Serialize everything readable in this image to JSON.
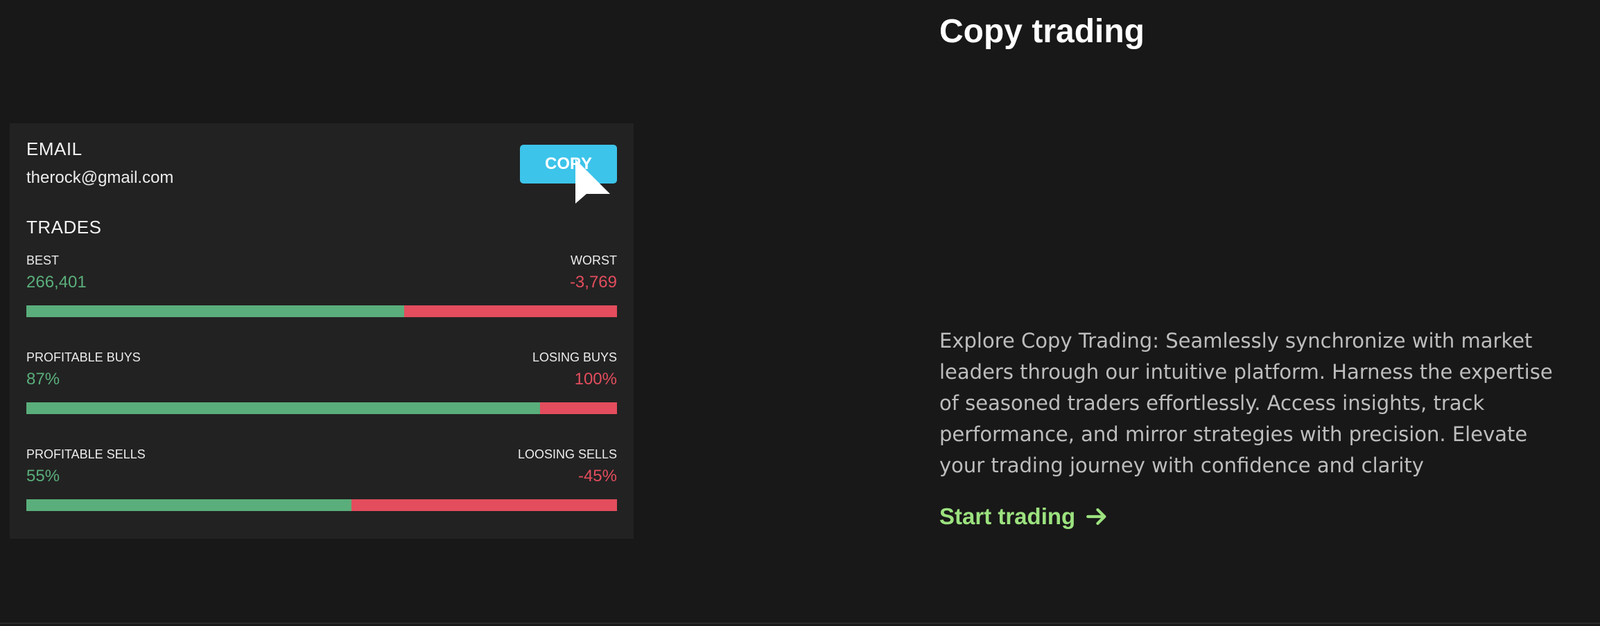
{
  "card": {
    "email_label": "EMAIL",
    "email_value": "therock@gmail.com",
    "copy_label": "COPY",
    "trades_label": "TRADES",
    "metrics": [
      {
        "left_label": "BEST",
        "right_label": "WORST",
        "left_value": "266,401",
        "right_value": "-3,769",
        "fill_fraction": 0.64
      },
      {
        "left_label": "PROFITABLE BUYS",
        "right_label": "LOSING BUYS",
        "left_value": "87%",
        "right_value": "100%",
        "fill_fraction": 0.87
      },
      {
        "left_label": "PROFITABLE SELLS",
        "right_label": "LOOSING SELLS",
        "left_value": "55%",
        "right_value": "-45%",
        "fill_fraction": 0.55
      }
    ]
  },
  "section": {
    "title": "Copy trading",
    "description": "Explore Copy Trading: Seamlessly synchronize with market leaders through our intuitive platform. Harness the expertise of seasoned traders effortlessly. Access insights, track performance, and mirror strategies with precision. Elevate your trading journey with confidence and clarity",
    "cta_label": "Start trading",
    "cta_icon": "arrow-right-icon"
  },
  "colors": {
    "background": "#181818",
    "card": "#222222",
    "accent_button": "#3cc4ea",
    "positive": "#5aae7b",
    "negative": "#e34d5d",
    "cta": "#9ce27f"
  }
}
